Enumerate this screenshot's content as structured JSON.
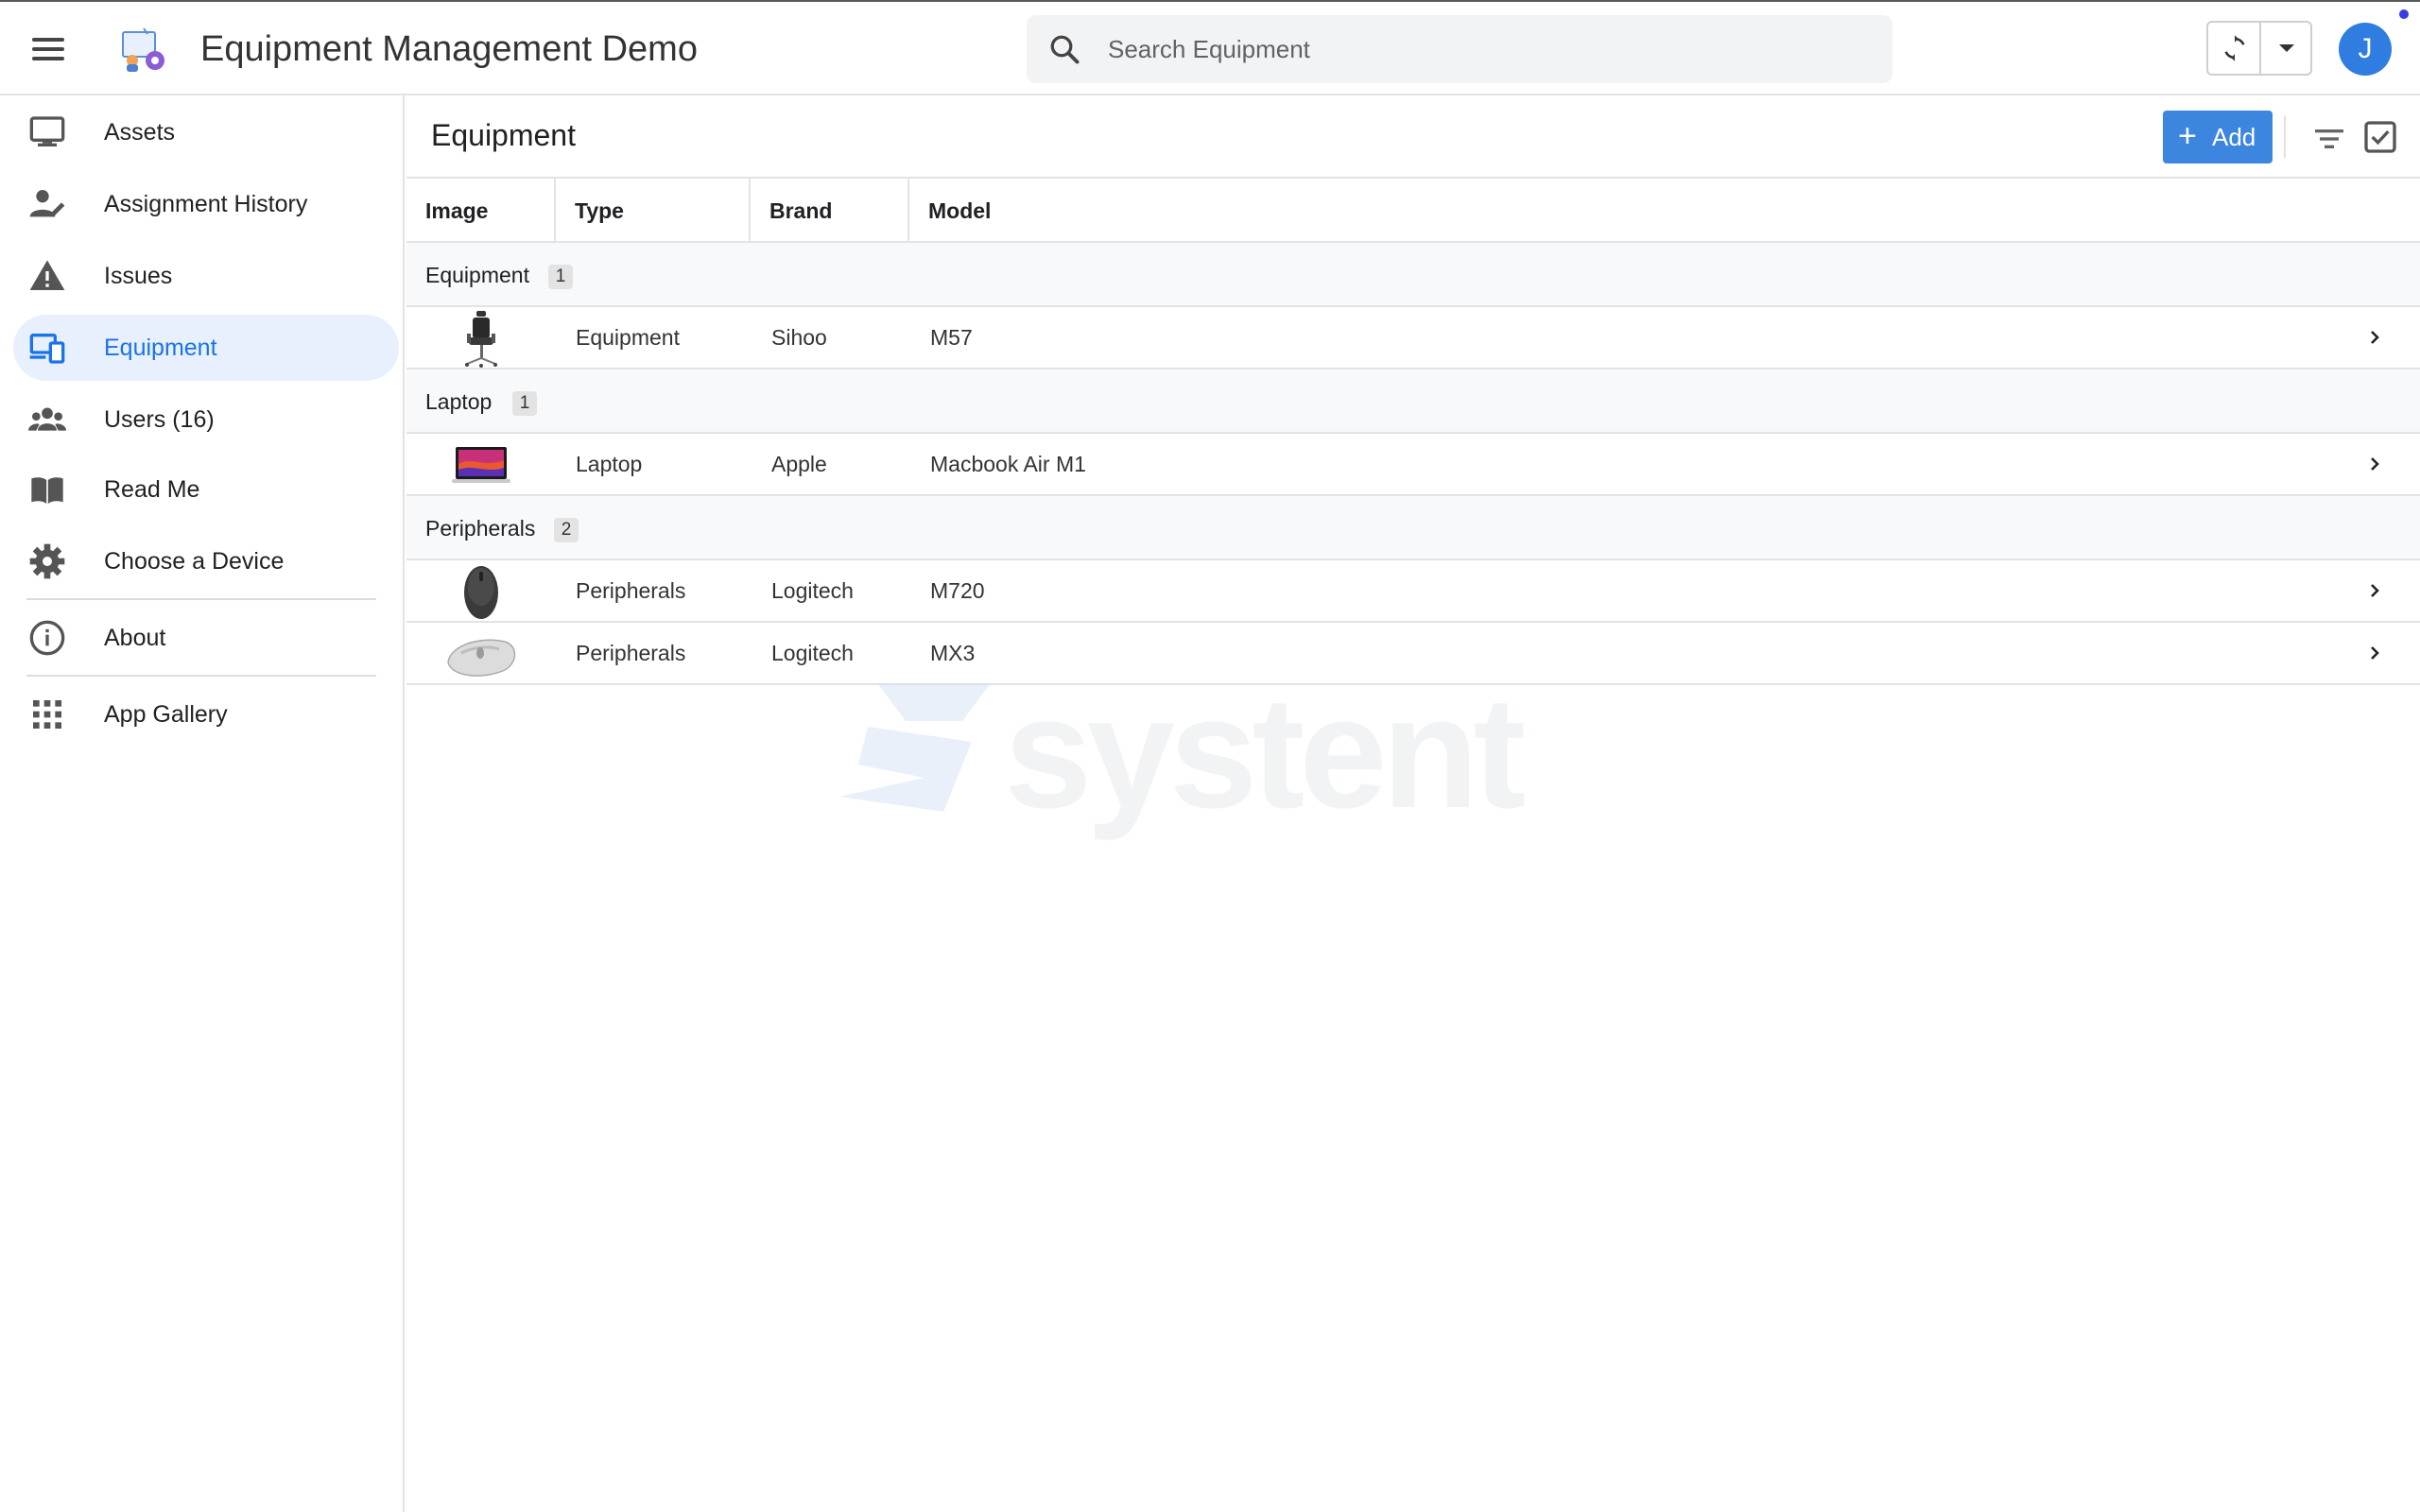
{
  "header": {
    "menu_icon": "hamburger-menu-icon",
    "app_title": "Equipment Management Demo",
    "search_placeholder": "Search Equipment",
    "avatar_initial": "J",
    "sync_icon": "sync-icon"
  },
  "sidebar": {
    "items": [
      {
        "label": "Assets",
        "icon": "monitor-icon",
        "active": false
      },
      {
        "label": "Assignment History",
        "icon": "user-edit-icon",
        "active": false
      },
      {
        "label": "Issues",
        "icon": "warning-icon",
        "active": false
      },
      {
        "label": "Equipment",
        "icon": "devices-icon",
        "active": true
      },
      {
        "label": "Users (16)",
        "icon": "users-icon",
        "active": false
      },
      {
        "label": "Read Me",
        "icon": "book-icon",
        "active": false
      },
      {
        "label": "Choose a Device",
        "icon": "gear-icon",
        "active": false
      },
      {
        "label": "About",
        "icon": "info-icon",
        "active": false
      },
      {
        "label": "App Gallery",
        "icon": "grid-icon",
        "active": false
      }
    ]
  },
  "main": {
    "title": "Equipment",
    "add_label": "Add",
    "columns": [
      "Image",
      "Type",
      "Brand",
      "Model"
    ],
    "groups": [
      {
        "name": "Equipment",
        "count": "1",
        "rows": [
          {
            "image": "office-chair",
            "type": "Equipment",
            "brand": "Sihoo",
            "model": "M57"
          }
        ]
      },
      {
        "name": "Laptop",
        "count": "1",
        "rows": [
          {
            "image": "laptop",
            "type": "Laptop",
            "brand": "Apple",
            "model": "Macbook Air M1"
          }
        ]
      },
      {
        "name": "Peripherals",
        "count": "2",
        "rows": [
          {
            "image": "dark-mouse",
            "type": "Peripherals",
            "brand": "Logitech",
            "model": "M720"
          },
          {
            "image": "light-mouse",
            "type": "Peripherals",
            "brand": "Logitech",
            "model": "MX3"
          }
        ]
      }
    ]
  },
  "watermark": {
    "text": "systent"
  },
  "colors": {
    "accent": "#1a73e8",
    "add_button": "#3d86e0",
    "avatar": "#2f7de1",
    "active_nav_bg": "#e8f0fe"
  }
}
